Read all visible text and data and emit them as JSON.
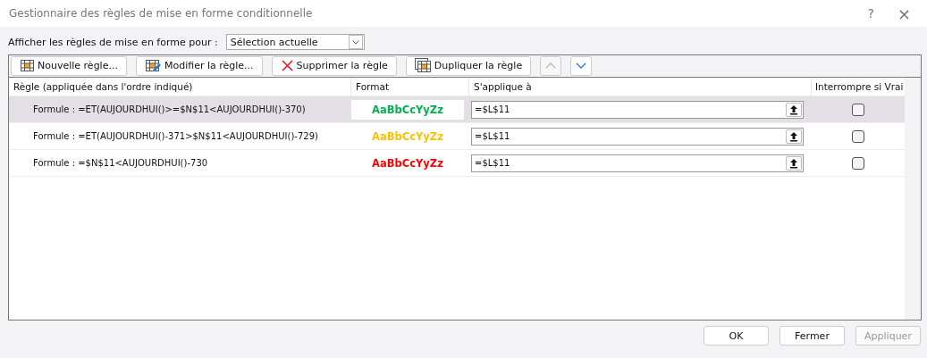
{
  "window": {
    "title": "Gestionnaire des règles de mise en forme conditionnelle",
    "help": "?",
    "close": "×"
  },
  "show_rules_for": {
    "label": "Afficher les règles de mise en forme pour :",
    "value": "Sélection actuelle"
  },
  "toolbar": [
    {
      "kind": "new",
      "label": "Nouvelle règle...",
      "disabled": false
    },
    {
      "kind": "edit",
      "label": "Modifier la règle...",
      "disabled": false
    },
    {
      "kind": "delete",
      "label": "Supprimer la règle",
      "disabled": false
    },
    {
      "kind": "duplicate",
      "label": "Dupliquer la règle",
      "disabled": false
    },
    {
      "kind": "up",
      "disabled": true
    },
    {
      "kind": "down",
      "disabled": false
    }
  ],
  "table": {
    "columns": [
      "Règle (appliquée dans l'ordre indiqué)",
      "Format",
      "S'applique à",
      "Interrompre si Vrai"
    ],
    "rows": [
      {
        "rule": "Formule : =ET(AUJOURDHUI()>=$N$11<AUJOURDHUI()-370)",
        "format": "AaBbCcYyZz",
        "color": "#00b050",
        "applies_to": "=$L$11",
        "stop_if_true": false,
        "selected": true
      },
      {
        "rule": "Formule : =ET(AUJOURDHUI()-371>$N$11<AUJOURDHUI()-729)",
        "format": "AaBbCcYyZz",
        "color": "#ffc000",
        "applies_to": "=$L$11",
        "stop_if_true": false,
        "selected": false
      },
      {
        "rule": "Formule : =$N$11<AUJOURDHUI()-730",
        "format": "AaBbCcYyZz",
        "color": "#ff0000",
        "applies_to": "=$L$11",
        "stop_if_true": false,
        "selected": false
      }
    ]
  },
  "buttons": [
    {
      "label": "OK",
      "disabled": false
    },
    {
      "label": "Fermer",
      "disabled": false
    },
    {
      "label": "Appliquer",
      "disabled": true
    }
  ]
}
